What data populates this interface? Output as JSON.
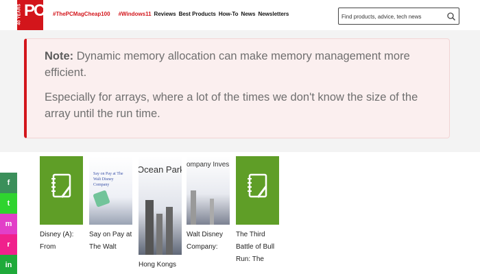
{
  "logo": {
    "text": "PC",
    "side_text": "40 YEARS"
  },
  "nav": {
    "hot_links": [
      "#ThePCMagCheap100",
      "#Windows11"
    ],
    "links": [
      "Reviews",
      "Best Products",
      "How-To",
      "News",
      "Newsletters"
    ]
  },
  "search": {
    "placeholder": "Find products, advice, tech news"
  },
  "note": {
    "label": "Note:",
    "line1": " Dynamic memory allocation can make memory management more efficient.",
    "line2": "Especially for arrays, where a lot of the times we don't know the size of the array until the run time."
  },
  "social": [
    "f",
    "t",
    "m",
    "r",
    "in"
  ],
  "cards": [
    {
      "title": "Disney (A): From",
      "thumb": "notebook-icon",
      "thumb_text": ""
    },
    {
      "title": "Say on Pay at The Walt",
      "thumb": "image",
      "thumb_text": "Say on Pay at The Walt Disney Company"
    },
    {
      "title": "Hong Kongs",
      "thumb": "image",
      "thumb_text": "Ocean Park Tal"
    },
    {
      "title": "Walt Disney Company:",
      "thumb": "image",
      "thumb_text": "ompany Inves ns Strategy"
    },
    {
      "title": "The Third Battle of Bull Run: The",
      "thumb": "notebook-icon",
      "thumb_text": ""
    }
  ],
  "colors": {
    "brand": "#d3151b",
    "card_green": "#5f9e27",
    "facebook": "#3b8f5a"
  }
}
